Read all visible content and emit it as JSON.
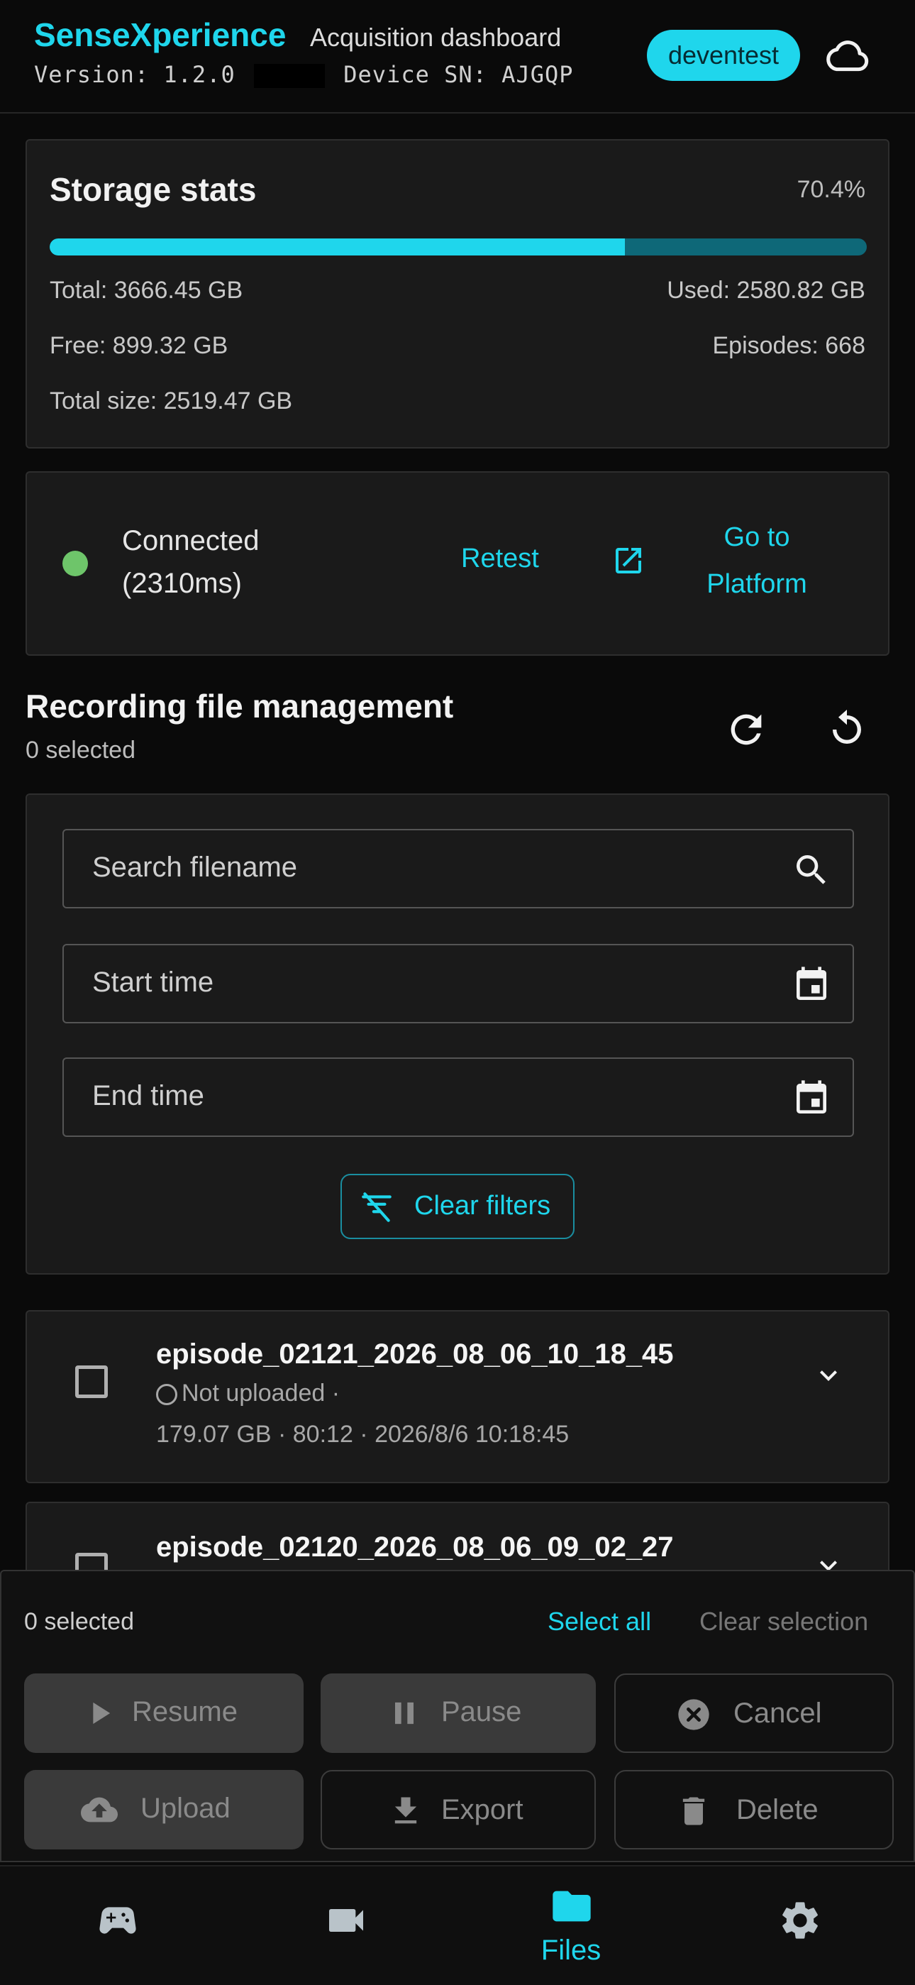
{
  "header": {
    "brand": "SenseXperience",
    "subtitle": "Acquisition dashboard",
    "version_label": "Version: 1.2.0",
    "device_sn_label": "Device SN: AJGQP",
    "user": "deventest",
    "cloud_icon": "cloud-icon"
  },
  "storage": {
    "title": "Storage stats",
    "percent_text": "70.4%",
    "used_fraction": 0.704,
    "total": "Total: 3666.45 GB",
    "used": "Used: 2580.82 GB",
    "free": "Free: 899.32 GB",
    "episodes": "Episodes: 668",
    "total_size": "Total size: 2519.47 GB"
  },
  "connection": {
    "status_line1": "Connected",
    "status_line2": "(2310ms)",
    "retest": "Retest",
    "goto_line1": "Go to",
    "goto_line2": "Platform",
    "status_color": "#6ec56a"
  },
  "files": {
    "title": "Recording file management",
    "selected": "0 selected"
  },
  "filters": {
    "search_placeholder": "Search filename",
    "start_placeholder": "Start time",
    "end_placeholder": "End time",
    "clear": "Clear filters"
  },
  "episodes": [
    {
      "name": "episode_02121_2026_08_06_10_18_45",
      "status": "Not uploaded ·",
      "meta": "179.07 GB · 80:12 · 2026/8/6 10:18:45"
    },
    {
      "name": "episode_02120_2026_08_06_09_02_27"
    }
  ],
  "actions": {
    "selected": "0 selected",
    "select_all": "Select all",
    "clear_selection": "Clear selection",
    "resume": "Resume",
    "pause": "Pause",
    "cancel": "Cancel",
    "upload": "Upload",
    "export": "Export",
    "delete": "Delete"
  },
  "nav": {
    "items": [
      {
        "icon": "gamepad-icon"
      },
      {
        "icon": "video-camera-icon"
      },
      {
        "icon": "folder-icon",
        "label": "Files",
        "active": true
      },
      {
        "icon": "gear-icon"
      }
    ]
  },
  "colors": {
    "accent": "#1fd6ec",
    "background": "#0a0a0a",
    "card": "#1a1a1a"
  }
}
